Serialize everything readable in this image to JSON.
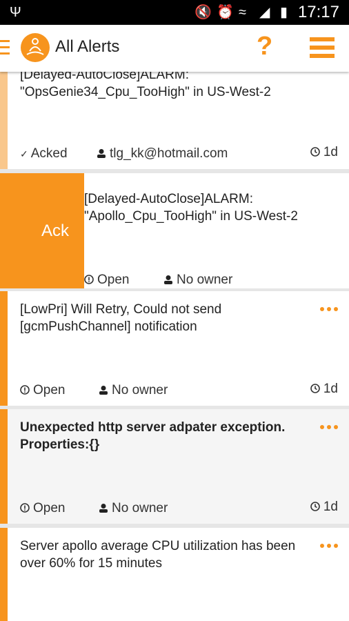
{
  "status_bar": {
    "time": "17:17",
    "icons": [
      "usb-icon",
      "mute-icon",
      "alarm-icon",
      "wifi-icon",
      "signal-icon",
      "battery-icon"
    ]
  },
  "app_bar": {
    "title": "All Alerts",
    "help_label": "?"
  },
  "colors": {
    "accent": "#f7941d",
    "card_bg": "#ffffff",
    "selected_bg": "#f5f5f5"
  },
  "alerts": [
    {
      "message": "[Delayed-AutoClose]ALARM: \"OpsGenie34_Cpu_TooHigh\" in US-West-2",
      "status": "Acked",
      "owner": "tlg_kk@hotmail.com",
      "age": "1d"
    },
    {
      "message": "[Delayed-AutoClose]ALARM: \"Apollo_Cpu_TooHigh\" in US-West-2",
      "status": "Open",
      "owner": "No owner",
      "swipe_action": "Ack"
    },
    {
      "message": "[LowPri] Will Retry, Could not send [gcmPushChannel] notification",
      "status": "Open",
      "owner": "No owner",
      "age": "1d"
    },
    {
      "message": "Unexpected http server adpater exception. Properties:{}",
      "status": "Open",
      "owner": "No owner",
      "age": "1d"
    },
    {
      "message": "Server apollo average CPU utilization has been over 60% for 15 minutes"
    }
  ]
}
